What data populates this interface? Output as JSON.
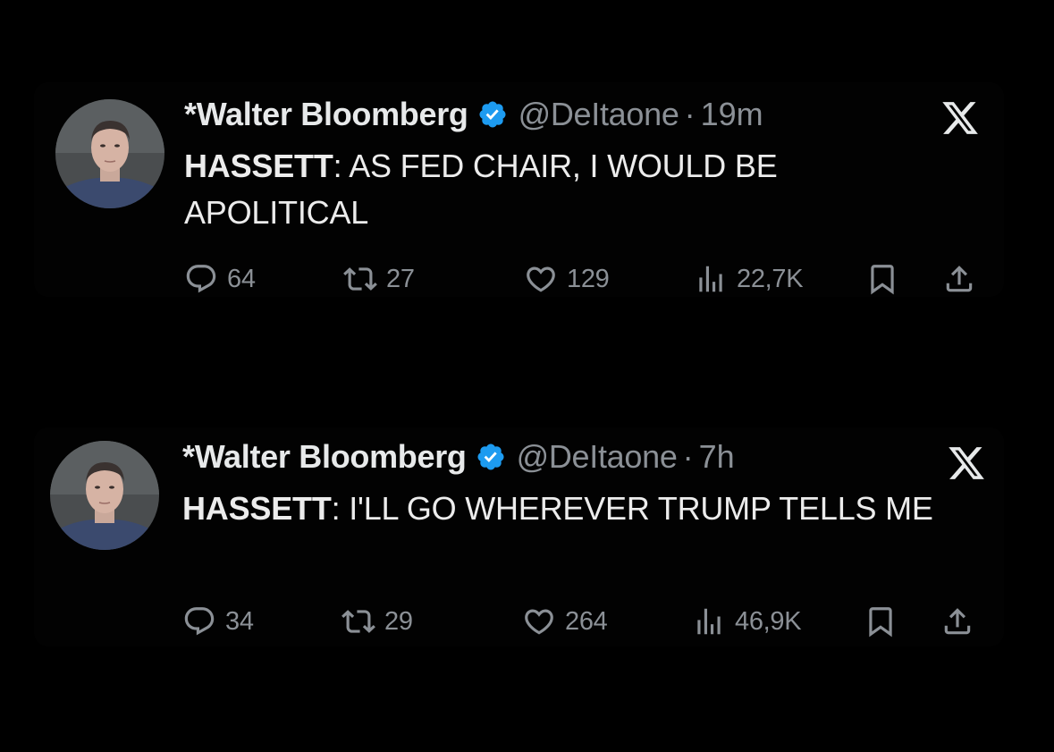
{
  "tweets": [
    {
      "author": "*Walter Bloomberg",
      "handle": "@DeItaone",
      "separator": "·",
      "time": "19m",
      "text_lead": "HASSETT",
      "text_rest": ": AS FED CHAIR, I WOULD BE APOLITICAL",
      "replies": "64",
      "retweets": "27",
      "likes": "129",
      "views": "22,7K"
    },
    {
      "author": "*Walter Bloomberg",
      "handle": "@DeItaone",
      "separator": "·",
      "time": "7h",
      "text_lead": "HASSETT",
      "text_rest": ": I'LL GO WHEREVER TRUMP TELLS ME",
      "replies": "34",
      "retweets": "29",
      "likes": "264",
      "views": "46,9K"
    }
  ],
  "icons": {
    "verified": "verified-badge-icon",
    "platform": "x-logo-icon",
    "reply": "reply-bubble-icon",
    "retweet": "retweet-icon",
    "like": "heart-icon",
    "views": "views-bar-chart-icon",
    "bookmark": "bookmark-icon",
    "share": "share-upload-icon"
  },
  "colors": {
    "background": "#000000",
    "text": "#e7e9ea",
    "muted": "#8b9096",
    "verified": "#1d9bf0"
  }
}
